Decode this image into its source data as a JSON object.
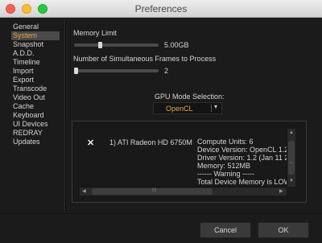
{
  "window": {
    "title": "Preferences"
  },
  "sidebar": {
    "items": [
      {
        "label": "General"
      },
      {
        "label": "System"
      },
      {
        "label": "Snapshot"
      },
      {
        "label": "A.D.D."
      },
      {
        "label": "Timeline"
      },
      {
        "label": "Import"
      },
      {
        "label": "Export"
      },
      {
        "label": "Transcode"
      },
      {
        "label": "Video Out"
      },
      {
        "label": "Cache"
      },
      {
        "label": "Keyboard"
      },
      {
        "label": "UI Devices"
      },
      {
        "label": "REDRAY"
      },
      {
        "label": "Updates"
      }
    ],
    "selected": "System"
  },
  "memory_limit": {
    "label": "Memory Limit",
    "value": "5.00GB",
    "slider_fraction": 0.3
  },
  "frames": {
    "label": "Number of Simultaneous Frames to Process",
    "value": "2",
    "slider_fraction": 0.0
  },
  "gpu_mode": {
    "label": "GPU Mode Selection:",
    "selected": "OpenCL"
  },
  "device": {
    "checked": true,
    "check_glyph": "✕",
    "name": "1) ATI Radeon HD 6750M",
    "info": [
      "Compute Units: 6",
      "Device Version: OpenCL 1.2",
      "Driver Version: 1.2 (Jan 11 2",
      "Memory: 512MB",
      "------ Warning -----",
      "Total Device Memory is LOW"
    ]
  },
  "buttons": {
    "cancel": "Cancel",
    "ok": "OK"
  },
  "colors": {
    "accent": "#e8a542",
    "background": "#1b1b1b"
  }
}
